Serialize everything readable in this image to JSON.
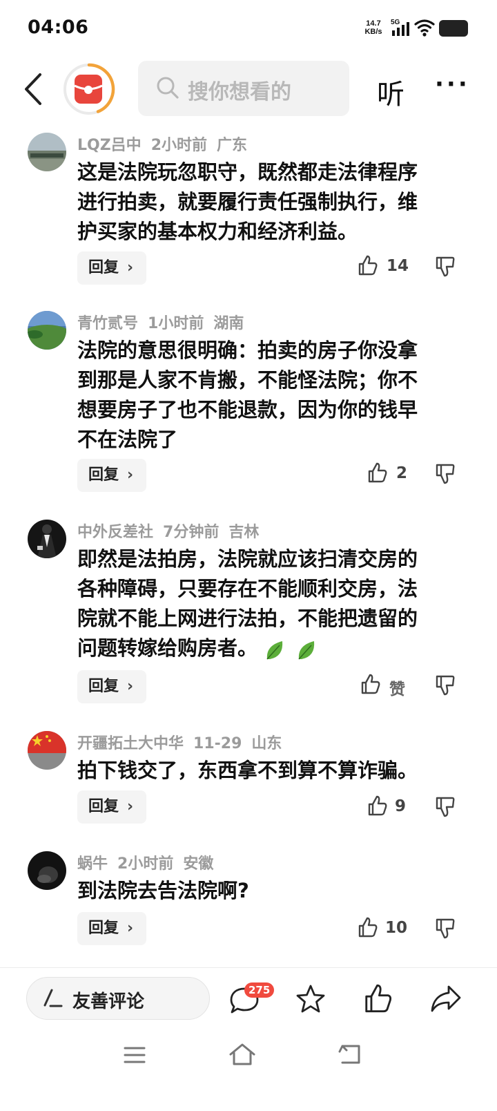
{
  "status_bar": {
    "time": "04:06",
    "net_speed_value": "14.7",
    "net_speed_unit": "KB/s",
    "network": "5G",
    "icons": [
      "signal-icon",
      "wifi-icon",
      "battery-icon"
    ]
  },
  "top_nav": {
    "search_placeholder": "搜你想看的",
    "listen_label": "听",
    "more_label": "···",
    "accent_color": "#f2a33a",
    "logo_color": "#e8453c"
  },
  "comments": [
    {
      "user": "LQZ吕中",
      "time": "2小时前",
      "region": "广东",
      "text": [
        "这是法院玩忽职守，既然都走法律程序",
        "进行拍卖，就要履行责任强制执行，维",
        "护买家的基本权力和经济利益。"
      ],
      "reply_label": "回复",
      "likes": "14"
    },
    {
      "user": "青竹贰号",
      "time": "1小时前",
      "region": "湖南",
      "text": [
        "法院的意思很明确：拍卖的房子你没拿",
        "到那是人家不肯搬，不能怪法院；你不",
        "想要房子了也不能退款，因为你的钱早",
        "不在法院了"
      ],
      "reply_label": "回复",
      "likes": "2"
    },
    {
      "user": "中外反差社",
      "time": "7分钟前",
      "region": "吉林",
      "text": [
        "即然是法拍房，法院就应该扫清交房的",
        "各种障碍，只要存在不能顺利交房，法",
        "院就不能上网进行法拍，不能把遗留的",
        "问题转嫁给购房者。"
      ],
      "reply_label": "回复",
      "likes": "赞"
    },
    {
      "user": "开疆拓土大中华",
      "time": "11-29",
      "region": "山东",
      "text": [
        "拍下钱交了，东西拿不到算不算诈骗。"
      ],
      "reply_label": "回复",
      "likes": "9"
    },
    {
      "user": "蜗牛",
      "time": "2小时前",
      "region": "安徽",
      "text": [
        "到法院去告法院啊?"
      ],
      "reply_label": "回复",
      "likes": "10"
    }
  ],
  "bottom_bar": {
    "comment_placeholder": "友善评论",
    "comment_count": "275",
    "icons": [
      "comment-icon",
      "star-icon",
      "thumbs-up-icon",
      "share-icon"
    ]
  },
  "nav_bar": {
    "icons": [
      "menu-icon",
      "home-icon",
      "back-icon"
    ]
  }
}
